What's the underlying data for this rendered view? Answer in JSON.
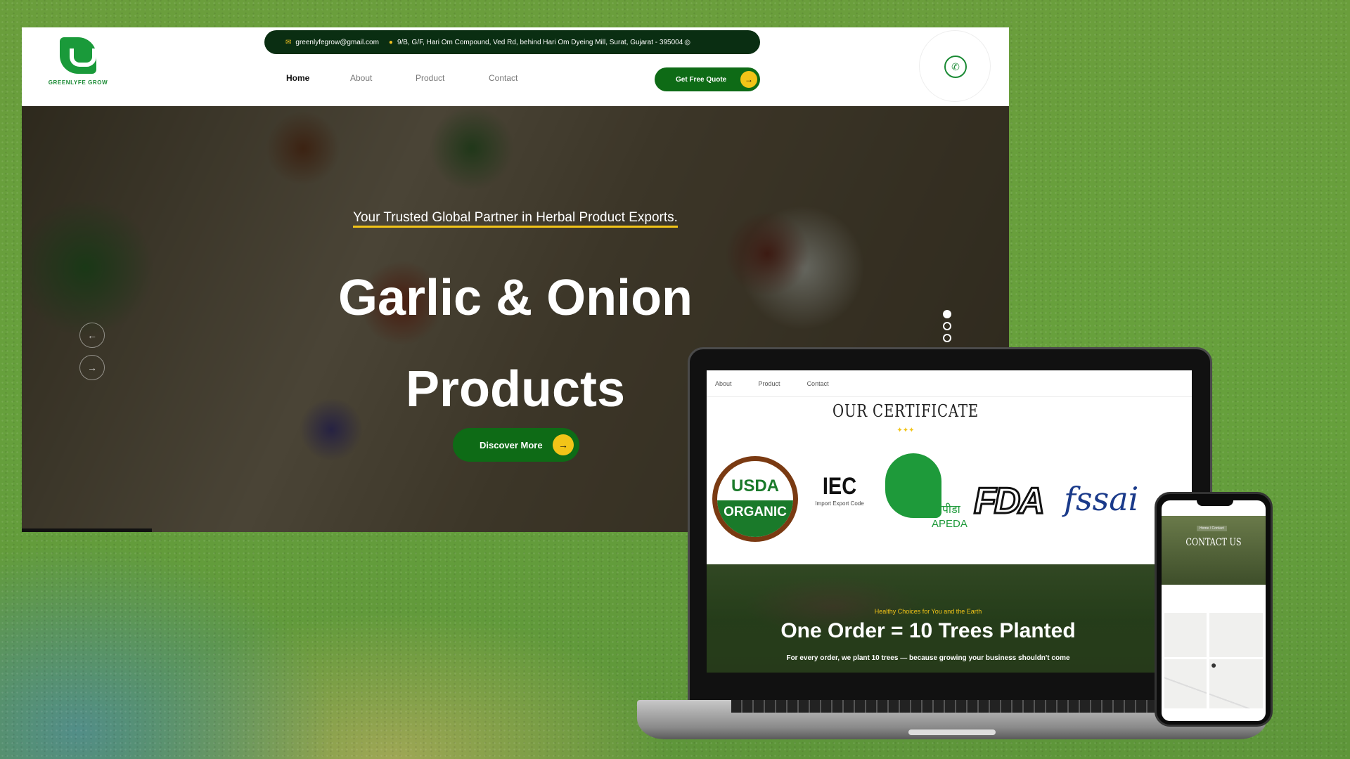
{
  "desktop": {
    "logo_text": "GREENLYFE GROW",
    "topbar": {
      "email": "greenlyfegrow@gmail.com",
      "address": "9/B, G/F, Hari Om Compound, Ved Rd, behind Hari Om Dyeing Mill, Surat, Gujarat - 395004"
    },
    "nav": {
      "home": "Home",
      "about": "About",
      "product": "Product",
      "contact": "Contact"
    },
    "quote_button": "Get Free Quote",
    "hero": {
      "tagline": "Your Trusted Global Partner in Herbal Product Exports.",
      "headline_line1": "Garlic & Onion",
      "headline_line2": "Products",
      "cta": "Discover More",
      "active_slide": 1,
      "slide_count": 3
    }
  },
  "laptop": {
    "nav": {
      "about": "About",
      "product": "Product",
      "contact": "Contact"
    },
    "certificate_title": "OUR CERTIFICATE",
    "certificates": {
      "usda_top": "USDA",
      "usda_bottom": "ORGANIC",
      "iec_big": "IEC",
      "iec_small": "Import Export Code",
      "apeda_hindi": "एपीडा",
      "apeda_en": "APEDA",
      "fda": "FDA",
      "fssai": "fssai"
    },
    "banner": {
      "kicker": "Healthy Choices for You and the Earth",
      "title": "One Order = 10 Trees Planted",
      "subtitle": "For every order, we plant 10 trees — because growing your business shouldn't come"
    }
  },
  "phone": {
    "breadcrumb": "Home / Contact",
    "title": "CONTACT US"
  },
  "colors": {
    "brand_green": "#0e6b16",
    "accent_yellow": "#f2c418",
    "topbar_dark": "#0a2e12",
    "background_green": "#66a03c"
  }
}
